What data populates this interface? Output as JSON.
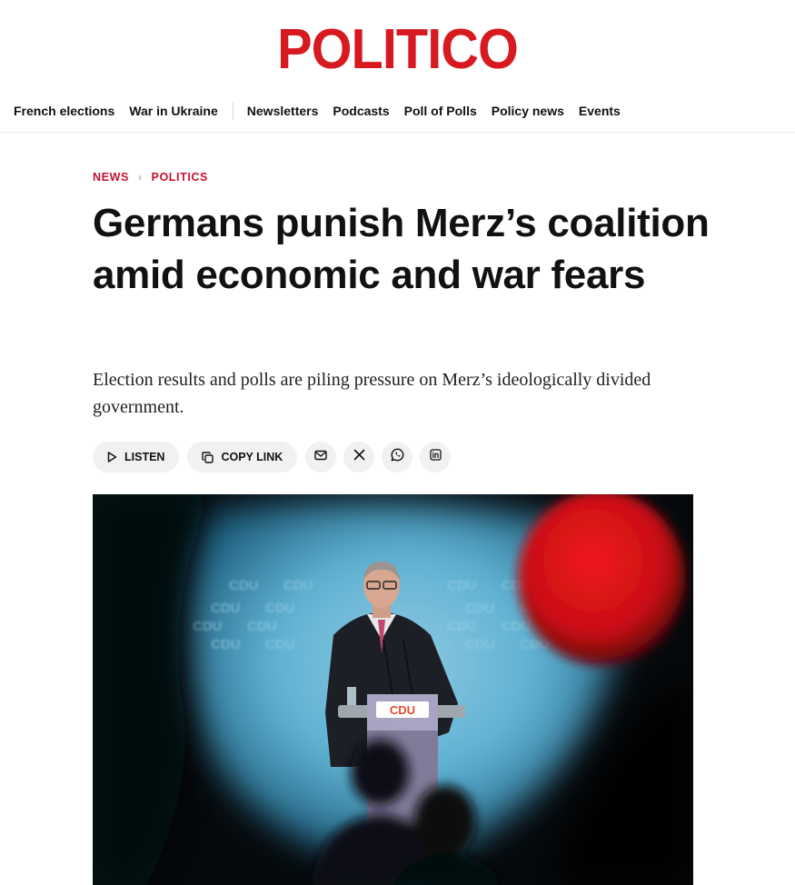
{
  "brand": {
    "logo_text": "POLITICO",
    "accent_color": "#d71920"
  },
  "nav": {
    "primary": [
      "French elections",
      "War in Ukraine"
    ],
    "secondary": [
      "Newsletters",
      "Podcasts",
      "Poll of Polls",
      "Policy news",
      "Events"
    ]
  },
  "breadcrumb": {
    "section": "NEWS",
    "subsection": "POLITICS"
  },
  "article": {
    "headline": "Germans punish Merz’s coalition amid economic and war fears",
    "dek": "Election results and polls are piling pressure on Merz’s ideologically divided government."
  },
  "share": {
    "listen_label": "LISTEN",
    "copy_link_label": "COPY LINK",
    "icons": [
      "mail-icon",
      "x-icon",
      "whatsapp-icon",
      "linkedin-icon"
    ]
  },
  "photo": {
    "backdrop_text": "CDU",
    "podium_text": "CDU"
  }
}
